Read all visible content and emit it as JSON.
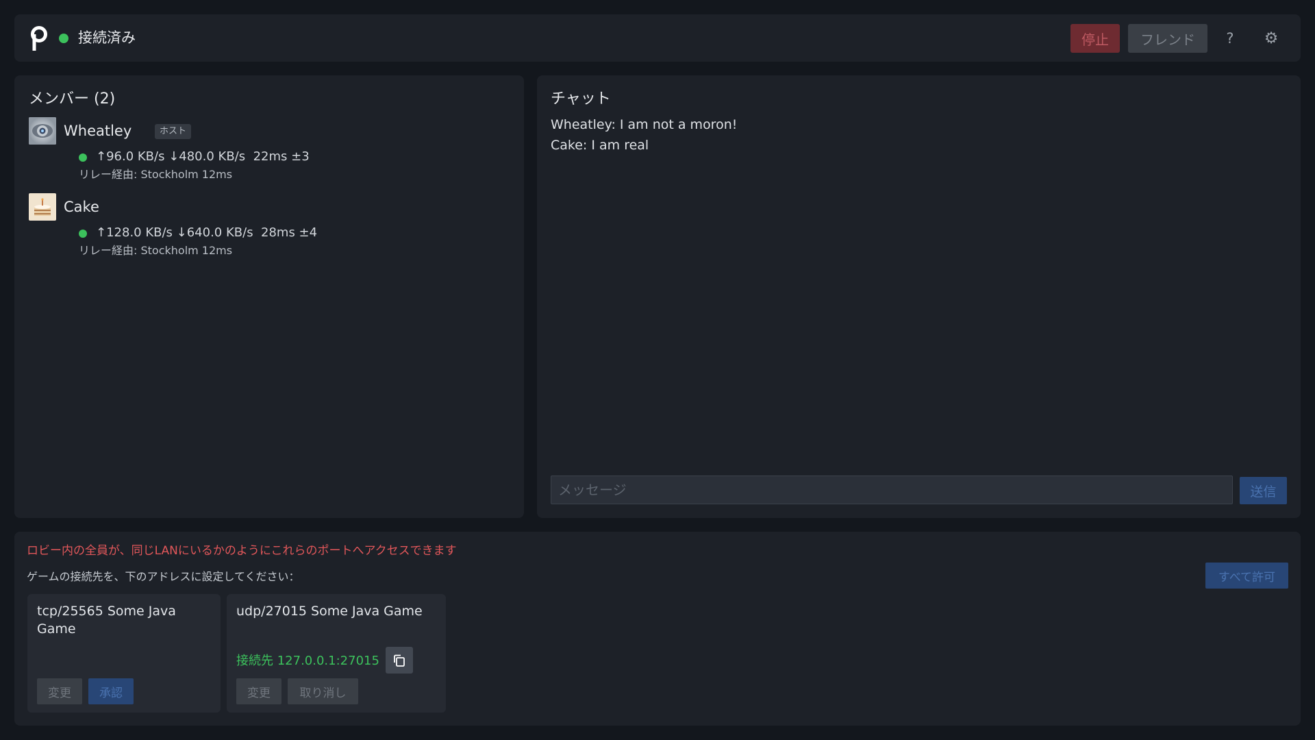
{
  "header": {
    "status": "接続済み",
    "stop_label": "停止",
    "friend_label": "フレンド",
    "help_label": "?",
    "settings_label": "⚙"
  },
  "members": {
    "title": "メンバー (2)",
    "items": [
      {
        "name": "Wheatley",
        "badge": "ホスト",
        "stats": "↑96.0 KB/s ↓480.0 KB/s  22ms ±3",
        "relay": "リレー経由: Stockholm 12ms",
        "avatar_icon": "eye-robot-avatar"
      },
      {
        "name": "Cake",
        "stats": "↑128.0 KB/s ↓640.0 KB/s  28ms ±4",
        "relay": "リレー経由: Stockholm 12ms",
        "avatar_icon": "cake-avatar"
      }
    ]
  },
  "chat": {
    "title": "チャット",
    "messages": [
      {
        "text": "Wheatley:  I am not a moron!"
      },
      {
        "text": "Cake:  I am real"
      }
    ],
    "input_placeholder": "メッセージ",
    "send_label": "送信"
  },
  "ports": {
    "warning": "ロビー内の全員が、同じLANにいるかのようにこれらのポートへアクセスできます",
    "hint": "ゲームの接続先を、下のアドレスに設定してください：",
    "allow_all_label": "すべて許可",
    "cards": [
      {
        "title": "tcp/25565 Some Java Game",
        "change_label": "変更",
        "approve_label": "承認"
      },
      {
        "title": "udp/27015 Some Java Game",
        "connection": "接続先 127.0.0.1:27015",
        "change_label": "変更",
        "cancel_label": "取り消し"
      }
    ]
  },
  "colors": {
    "background": "#13171d",
    "panel": "#1d2128",
    "online": "#3cc15c",
    "danger": "#e2575a",
    "primary": "#284676"
  }
}
